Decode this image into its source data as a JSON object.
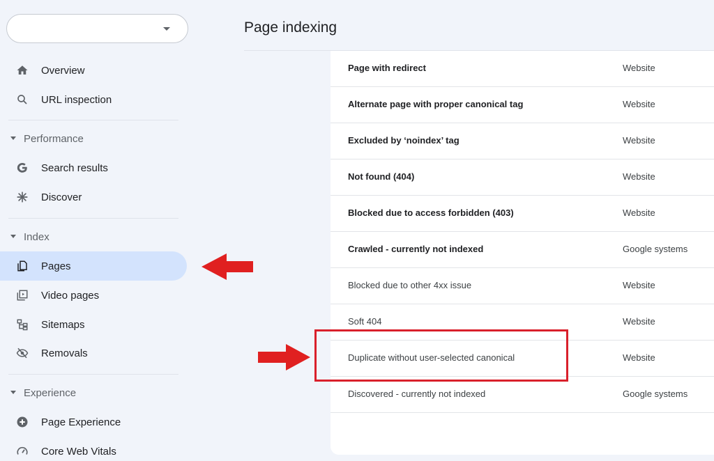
{
  "sidebar": {
    "property_selector": "",
    "items": {
      "overview": {
        "label": "Overview",
        "icon": "home-icon"
      },
      "url_inspection": {
        "label": "URL inspection",
        "icon": "search-icon"
      },
      "search_results": {
        "label": "Search results",
        "icon": "google-g-icon"
      },
      "discover": {
        "label": "Discover",
        "icon": "asterisk-icon"
      },
      "pages": {
        "label": "Pages",
        "icon": "pages-icon",
        "active": true
      },
      "video_pages": {
        "label": "Video pages",
        "icon": "video-pages-icon"
      },
      "sitemaps": {
        "label": "Sitemaps",
        "icon": "sitemap-icon"
      },
      "removals": {
        "label": "Removals",
        "icon": "eye-off-icon"
      },
      "page_experience": {
        "label": "Page Experience",
        "icon": "plus-circle-icon"
      },
      "core_web_vitals": {
        "label": "Core Web Vitals",
        "icon": "gauge-icon"
      }
    },
    "sections": {
      "performance": "Performance",
      "index": "Index",
      "experience": "Experience"
    }
  },
  "main": {
    "title": "Page indexing",
    "rows": [
      {
        "reason": "Page with redirect",
        "source": "Website",
        "bold": true
      },
      {
        "reason": "Alternate page with proper canonical tag",
        "source": "Website",
        "bold": true
      },
      {
        "reason": "Excluded by ‘noindex’ tag",
        "source": "Website",
        "bold": true
      },
      {
        "reason": "Not found (404)",
        "source": "Website",
        "bold": true
      },
      {
        "reason": "Blocked due to access forbidden (403)",
        "source": "Website",
        "bold": true
      },
      {
        "reason": "Crawled - currently not indexed",
        "source": "Google systems",
        "bold": true
      },
      {
        "reason": "Blocked due to other 4xx issue",
        "source": "Website",
        "bold": false
      },
      {
        "reason": "Soft 404",
        "source": "Website",
        "bold": false
      },
      {
        "reason": "Duplicate without user-selected canonical",
        "source": "Website",
        "bold": false
      },
      {
        "reason": "Discovered - currently not indexed",
        "source": "Google systems",
        "bold": false
      }
    ]
  },
  "annotations": {
    "arrow_color": "#e02020",
    "box_color": "#d9202b"
  }
}
